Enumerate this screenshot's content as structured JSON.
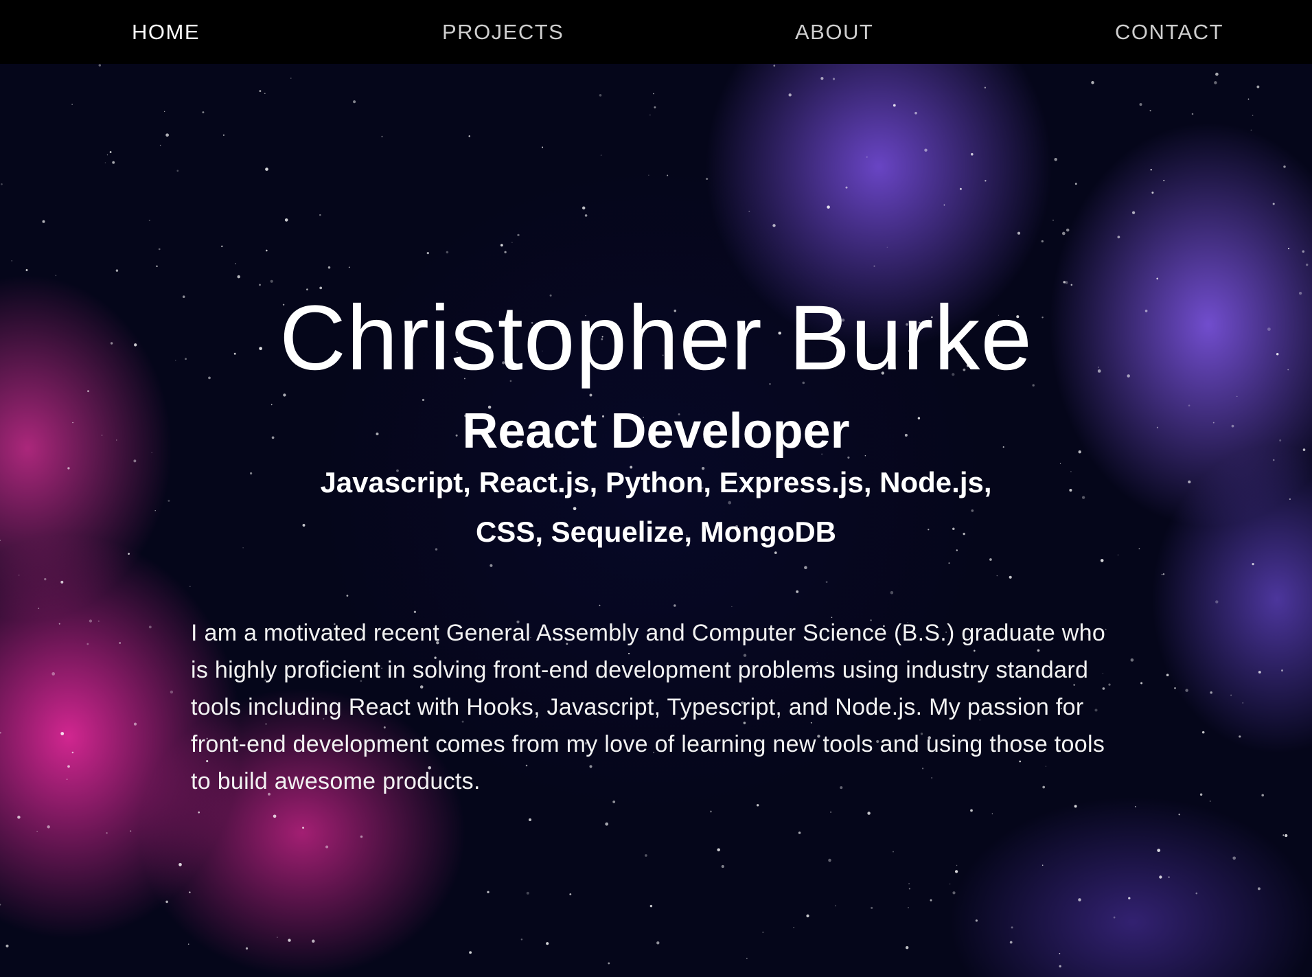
{
  "navbar": {
    "items": [
      {
        "label": "HOME",
        "active": true
      },
      {
        "label": "PROJECTS",
        "active": false
      },
      {
        "label": "ABOUT",
        "active": false
      },
      {
        "label": "CONTACT",
        "active": false
      }
    ]
  },
  "hero": {
    "name": "Christopher Burke",
    "role": "React Developer",
    "skills_line1": "Javascript, React.js, Python, Express.js, Node.js,",
    "skills_line2": "CSS, Sequelize, MongoDB",
    "bio": "I am a motivated recent General Assembly and Computer Science (B.S.) graduate who is highly proficient in solving front-end development problems using industry standard tools including React with Hooks, Javascript, Typescript, and Node.js. My passion for front-end development comes from my love of learning new tools and using those tools to build awesome products."
  },
  "colors": {
    "nav_background": "#000000",
    "nav_active": "#ffffff",
    "nav_inactive": "#cfcfcf",
    "background_dark": "#05061a",
    "nebula_pink": "#dc2896",
    "nebula_purple": "#6e48cd"
  }
}
